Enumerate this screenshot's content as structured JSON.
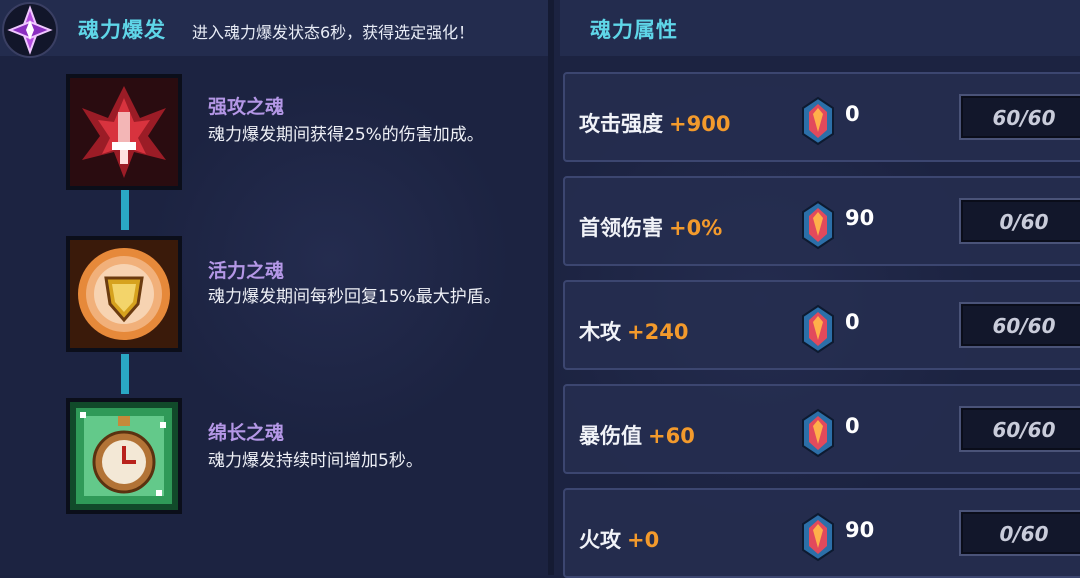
{
  "left": {
    "title": "魂力爆发",
    "description": "进入魂力爆发状态6秒，获得选定强化！",
    "skills": [
      {
        "name": "强攻之魂",
        "desc": "魂力爆发期间获得25%的伤害加成。",
        "icon": "red-attack-soul-icon"
      },
      {
        "name": "活力之魂",
        "desc": "魂力爆发期间每秒回复15%最大护盾。",
        "icon": "shield-vitality-soul-icon"
      },
      {
        "name": "绵长之魂",
        "desc": "魂力爆发持续时间增加5秒。",
        "icon": "stopwatch-duration-soul-icon"
      }
    ]
  },
  "right": {
    "title": "魂力属性",
    "attributes": [
      {
        "name": "攻击强度",
        "bonus": "+900",
        "gems": "0",
        "progress": "60/60"
      },
      {
        "name": "首领伤害",
        "bonus": "+0%",
        "gems": "90",
        "progress": "0/60"
      },
      {
        "name": "木攻",
        "bonus": "+240",
        "gems": "0",
        "progress": "60/60"
      },
      {
        "name": "暴伤值",
        "bonus": "+60",
        "gems": "0",
        "progress": "60/60"
      },
      {
        "name": "火攻",
        "bonus": "+0",
        "gems": "90",
        "progress": "0/60"
      }
    ]
  },
  "colors": {
    "title": "#5fd6e8",
    "skill_name": "#b497e6",
    "bonus": "#f39a2c",
    "connector": "#2aa7c4"
  }
}
